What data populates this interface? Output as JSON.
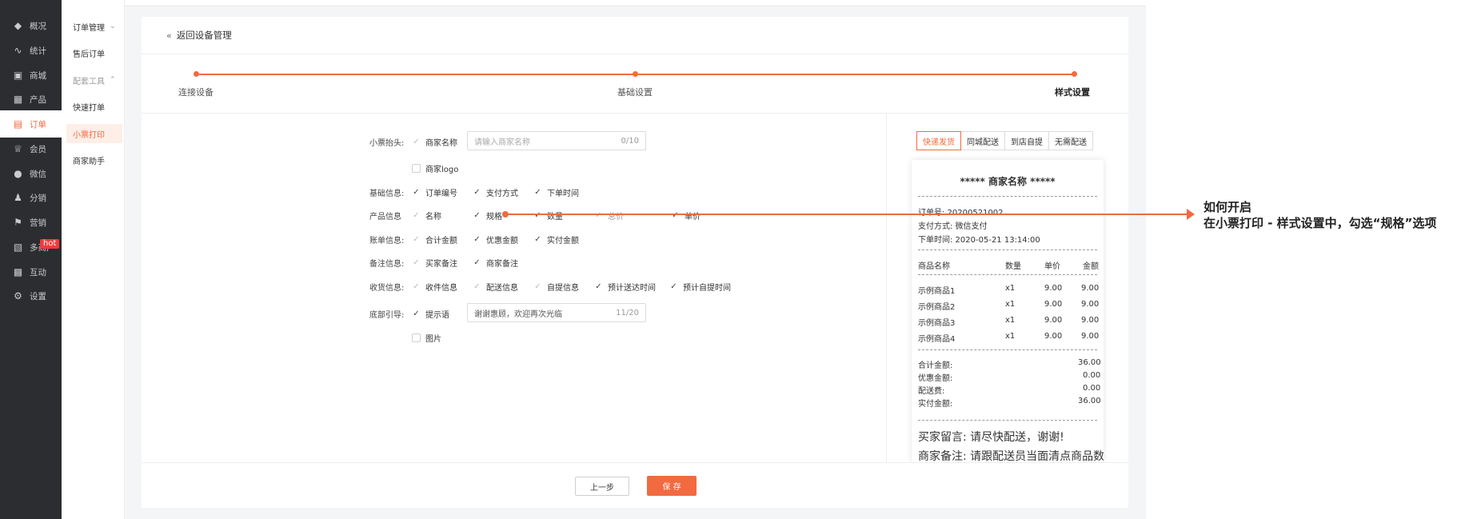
{
  "main_nav": [
    {
      "label": "概况",
      "icon": "graduation-cap-icon"
    },
    {
      "label": "统计",
      "icon": "chart-icon"
    },
    {
      "label": "商城",
      "icon": "store-icon"
    },
    {
      "label": "产品",
      "icon": "grid-icon"
    },
    {
      "label": "订单",
      "icon": "order-icon"
    },
    {
      "label": "会员",
      "icon": "crown-icon"
    },
    {
      "label": "微信",
      "icon": "wechat-icon"
    },
    {
      "label": "分销",
      "icon": "users-icon"
    },
    {
      "label": "营销",
      "icon": "flag-icon"
    },
    {
      "label": "多商户",
      "icon": "merchant-icon"
    },
    {
      "label": "互动",
      "icon": "interact-icon"
    },
    {
      "label": "设置",
      "icon": "gear-icon"
    }
  ],
  "hot_badge": "hot",
  "sub_nav": [
    {
      "label": "订单管理",
      "group": true
    },
    {
      "label": "售后订单"
    },
    {
      "label": "配套工具",
      "group": true
    },
    {
      "label": "快速打单"
    },
    {
      "label": "小票打印"
    },
    {
      "label": "商家助手"
    }
  ],
  "back_link": "返回设备管理",
  "steps": [
    "连接设备",
    "基础设置",
    "样式设置"
  ],
  "form": {
    "header_label": "小票抬头:",
    "merchant_name": "商家名称",
    "merchant_name_placeholder": "请输入商家名称",
    "merchant_name_count": "0/10",
    "merchant_logo": "商家logo",
    "basic_label": "基础信息:",
    "basic": [
      "订单编号",
      "支付方式",
      "下单时间"
    ],
    "product_label": "产品信息",
    "product": [
      "名称",
      "规格",
      "数量",
      "总价",
      "单价"
    ],
    "bill_label": "账单信息:",
    "bill": [
      "合计金额",
      "优惠金额",
      "实付金额"
    ],
    "remark_label": "备注信息:",
    "remark": [
      "买家备注",
      "商家备注"
    ],
    "receive_label": "收货信息:",
    "receive": [
      "收件信息",
      "配送信息",
      "自提信息",
      "预计送达时间",
      "预计自提时间"
    ],
    "footer_label": "底部引导:",
    "tip": "提示语",
    "tip_value": "谢谢惠顾，欢迎再次光临",
    "tip_count": "11/20",
    "image": "图片"
  },
  "preview": {
    "tabs": [
      "快递发货",
      "同城配送",
      "到店自提",
      "无需配送"
    ],
    "title": "***** 商家名称 *****",
    "order_no": "订单号: 20200521002",
    "pay_method": "支付方式: 微信支付",
    "order_time": "下单时间: 2020-05-21 13:14:00",
    "headers": [
      "商品名称",
      "数量",
      "单价",
      "金额"
    ],
    "items": [
      {
        "name": "示例商品1",
        "qty": "x1",
        "price": "9.00",
        "amount": "9.00"
      },
      {
        "name": "示例商品2",
        "qty": "x1",
        "price": "9.00",
        "amount": "9.00"
      },
      {
        "name": "示例商品3",
        "qty": "x1",
        "price": "9.00",
        "amount": "9.00"
      },
      {
        "name": "示例商品4",
        "qty": "x1",
        "price": "9.00",
        "amount": "9.00"
      }
    ],
    "totals": [
      {
        "label": "合计金额:",
        "value": "36.00"
      },
      {
        "label": "优惠金额:",
        "value": "0.00"
      },
      {
        "label": "配送费:",
        "value": "0.00"
      },
      {
        "label": "实付金额:",
        "value": "36.00"
      }
    ],
    "buyer_note": "买家留言: 请尽快配送，谢谢!",
    "seller_note": "商家备注: 请跟配送员当面清点商品数"
  },
  "buttons": {
    "prev": "上一步",
    "save": "保 存"
  },
  "annotation": {
    "title": "如何开启",
    "desc": "在小票打印 - 样式设置中，勾选“规格”选项"
  },
  "accent_color": "#f26a3f"
}
